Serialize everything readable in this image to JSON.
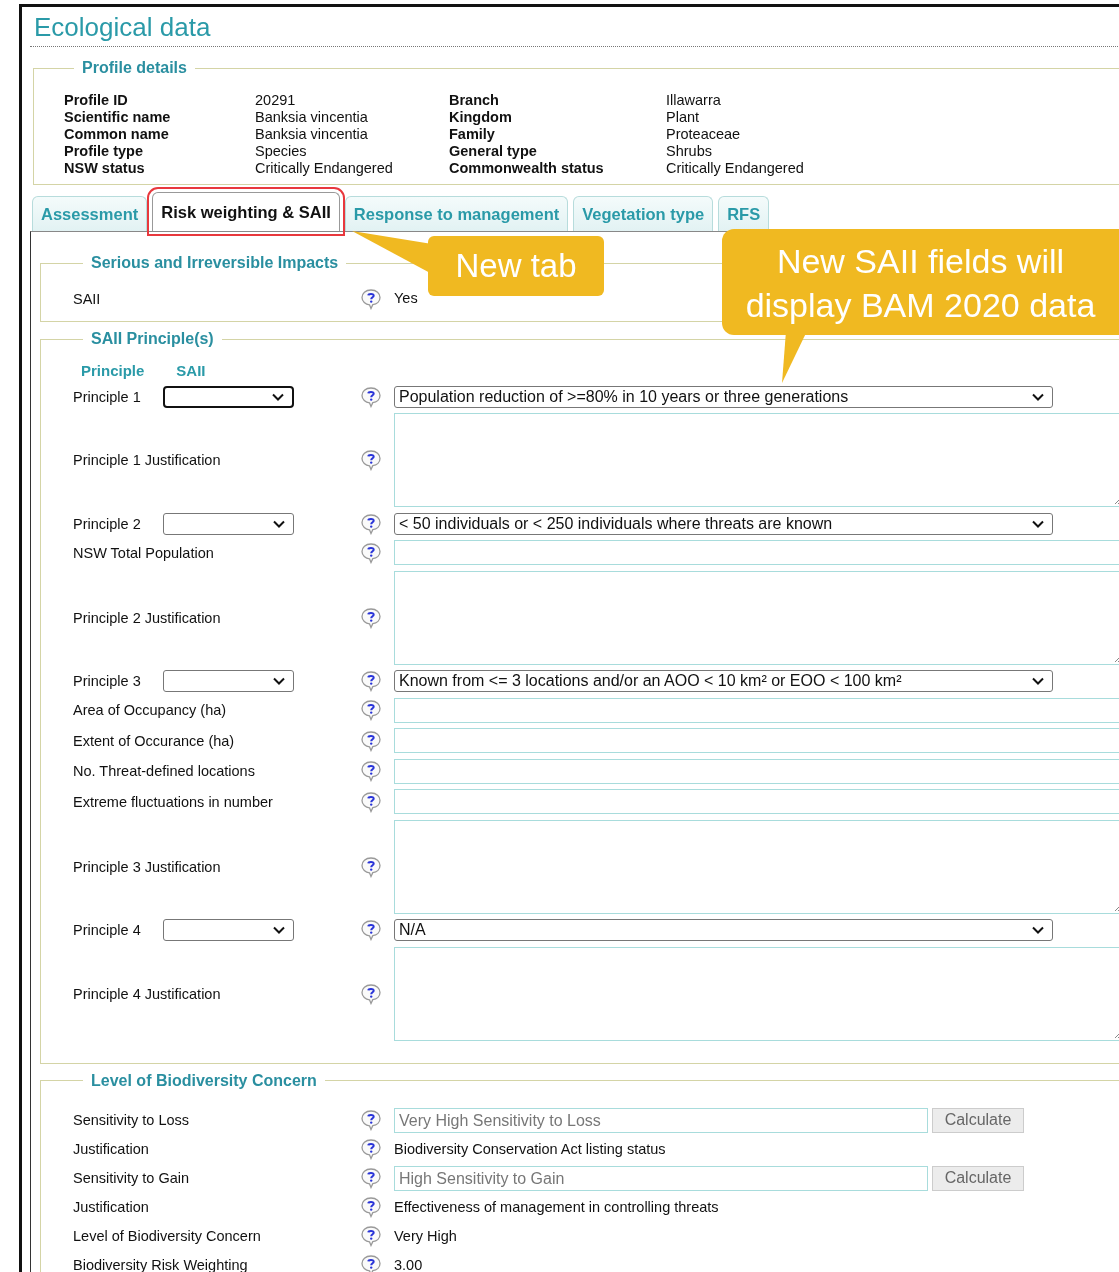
{
  "title": "Ecological data",
  "profile": {
    "legend": "Profile details",
    "rows": [
      {
        "label": "Profile ID",
        "value": "20291",
        "label2": "Branch",
        "value2": "Illawarra"
      },
      {
        "label": "Scientific name",
        "value": "Banksia vincentia",
        "label2": "Kingdom",
        "value2": "Plant"
      },
      {
        "label": "Common name",
        "value": "Banksia vincentia",
        "label2": "Family",
        "value2": "Proteaceae"
      },
      {
        "label": "Profile type",
        "value": "Species",
        "label2": "General type",
        "value2": "Shrubs"
      },
      {
        "label": "NSW status",
        "value": "Critically Endangered",
        "label2": "Commonwealth status",
        "value2": "Critically Endangered"
      }
    ]
  },
  "tabs": [
    {
      "label": "Assessment",
      "selected": false,
      "highlighted": false
    },
    {
      "label": "Risk weighting & SAII",
      "selected": true,
      "highlighted": true
    },
    {
      "label": "Response to management",
      "selected": false,
      "highlighted": false
    },
    {
      "label": "Vegetation type",
      "selected": false,
      "highlighted": false
    },
    {
      "label": "RFS",
      "selected": false,
      "highlighted": false
    }
  ],
  "sections": [
    {
      "legend": "Serious and Irreversible Impacts",
      "rows": [
        {
          "kind": "value",
          "label": "SAII",
          "value": "Yes"
        }
      ]
    },
    {
      "legend": "SAII Principle(s)",
      "columns": [
        "Principle",
        "SAII"
      ],
      "rows": [
        {
          "kind": "principle",
          "label": "Principle 1",
          "focused": true,
          "value": "Population reduction of >=80% in 10 years or three generations"
        },
        {
          "kind": "textarea",
          "label": "Principle 1 Justification"
        },
        {
          "kind": "principle",
          "label": "Principle 2",
          "focused": false,
          "value": "< 50 individuals or < 250 individuals where threats are known"
        },
        {
          "kind": "input",
          "label": "NSW Total Population"
        },
        {
          "kind": "textarea",
          "label": "Principle 2 Justification"
        },
        {
          "kind": "principle",
          "label": "Principle 3",
          "focused": false,
          "value": "Known from <= 3 locations and/or an AOO < 10 km² or EOO < 100 km²"
        },
        {
          "kind": "input",
          "label": "Area of Occupancy (ha)"
        },
        {
          "kind": "input",
          "label": "Extent of Occurance (ha)"
        },
        {
          "kind": "input",
          "label": "No. Threat-defined locations"
        },
        {
          "kind": "input",
          "label": "Extreme fluctuations in number"
        },
        {
          "kind": "textarea",
          "label": "Principle 3 Justification"
        },
        {
          "kind": "principle",
          "label": "Principle 4",
          "focused": false,
          "value": "N/A"
        },
        {
          "kind": "textarea",
          "label": "Principle 4 Justification"
        }
      ]
    },
    {
      "legend": "Level of Biodiversity Concern",
      "rows": [
        {
          "kind": "calc",
          "label": "Sensitivity to Loss",
          "value": "Very High Sensitivity to Loss",
          "button": "Calculate"
        },
        {
          "kind": "value",
          "label": "Justification",
          "value": "Biodiversity Conservation Act listing status"
        },
        {
          "kind": "calc",
          "label": "Sensitivity to Gain",
          "value": "High Sensitivity to Gain",
          "button": "Calculate"
        },
        {
          "kind": "value",
          "label": "Justification",
          "value": "Effectiveness of management in controlling threats"
        },
        {
          "kind": "value",
          "label": "Level of Biodiversity Concern",
          "value": "Very High"
        },
        {
          "kind": "value",
          "label": "Biodiversity Risk Weighting",
          "value": "3.00"
        }
      ]
    }
  ],
  "callouts": [
    {
      "kind": "tab",
      "text": "New tab"
    },
    {
      "kind": "fields",
      "text": "New SAII fields will display BAM 2020 data"
    }
  ]
}
